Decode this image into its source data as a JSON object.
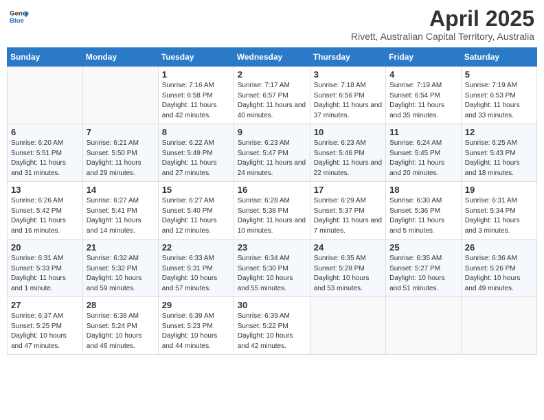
{
  "header": {
    "logo_general": "General",
    "logo_blue": "Blue",
    "month_year": "April 2025",
    "location": "Rivett, Australian Capital Territory, Australia"
  },
  "days_of_week": [
    "Sunday",
    "Monday",
    "Tuesday",
    "Wednesday",
    "Thursday",
    "Friday",
    "Saturday"
  ],
  "weeks": [
    [
      {
        "day": "",
        "sunrise": "",
        "sunset": "",
        "daylight": ""
      },
      {
        "day": "",
        "sunrise": "",
        "sunset": "",
        "daylight": ""
      },
      {
        "day": "1",
        "sunrise": "Sunrise: 7:16 AM",
        "sunset": "Sunset: 6:58 PM",
        "daylight": "Daylight: 11 hours and 42 minutes."
      },
      {
        "day": "2",
        "sunrise": "Sunrise: 7:17 AM",
        "sunset": "Sunset: 6:57 PM",
        "daylight": "Daylight: 11 hours and 40 minutes."
      },
      {
        "day": "3",
        "sunrise": "Sunrise: 7:18 AM",
        "sunset": "Sunset: 6:56 PM",
        "daylight": "Daylight: 11 hours and 37 minutes."
      },
      {
        "day": "4",
        "sunrise": "Sunrise: 7:19 AM",
        "sunset": "Sunset: 6:54 PM",
        "daylight": "Daylight: 11 hours and 35 minutes."
      },
      {
        "day": "5",
        "sunrise": "Sunrise: 7:19 AM",
        "sunset": "Sunset: 6:53 PM",
        "daylight": "Daylight: 11 hours and 33 minutes."
      }
    ],
    [
      {
        "day": "6",
        "sunrise": "Sunrise: 6:20 AM",
        "sunset": "Sunset: 5:51 PM",
        "daylight": "Daylight: 11 hours and 31 minutes."
      },
      {
        "day": "7",
        "sunrise": "Sunrise: 6:21 AM",
        "sunset": "Sunset: 5:50 PM",
        "daylight": "Daylight: 11 hours and 29 minutes."
      },
      {
        "day": "8",
        "sunrise": "Sunrise: 6:22 AM",
        "sunset": "Sunset: 5:49 PM",
        "daylight": "Daylight: 11 hours and 27 minutes."
      },
      {
        "day": "9",
        "sunrise": "Sunrise: 6:23 AM",
        "sunset": "Sunset: 5:47 PM",
        "daylight": "Daylight: 11 hours and 24 minutes."
      },
      {
        "day": "10",
        "sunrise": "Sunrise: 6:23 AM",
        "sunset": "Sunset: 5:46 PM",
        "daylight": "Daylight: 11 hours and 22 minutes."
      },
      {
        "day": "11",
        "sunrise": "Sunrise: 6:24 AM",
        "sunset": "Sunset: 5:45 PM",
        "daylight": "Daylight: 11 hours and 20 minutes."
      },
      {
        "day": "12",
        "sunrise": "Sunrise: 6:25 AM",
        "sunset": "Sunset: 5:43 PM",
        "daylight": "Daylight: 11 hours and 18 minutes."
      }
    ],
    [
      {
        "day": "13",
        "sunrise": "Sunrise: 6:26 AM",
        "sunset": "Sunset: 5:42 PM",
        "daylight": "Daylight: 11 hours and 16 minutes."
      },
      {
        "day": "14",
        "sunrise": "Sunrise: 6:27 AM",
        "sunset": "Sunset: 5:41 PM",
        "daylight": "Daylight: 11 hours and 14 minutes."
      },
      {
        "day": "15",
        "sunrise": "Sunrise: 6:27 AM",
        "sunset": "Sunset: 5:40 PM",
        "daylight": "Daylight: 11 hours and 12 minutes."
      },
      {
        "day": "16",
        "sunrise": "Sunrise: 6:28 AM",
        "sunset": "Sunset: 5:38 PM",
        "daylight": "Daylight: 11 hours and 10 minutes."
      },
      {
        "day": "17",
        "sunrise": "Sunrise: 6:29 AM",
        "sunset": "Sunset: 5:37 PM",
        "daylight": "Daylight: 11 hours and 7 minutes."
      },
      {
        "day": "18",
        "sunrise": "Sunrise: 6:30 AM",
        "sunset": "Sunset: 5:36 PM",
        "daylight": "Daylight: 11 hours and 5 minutes."
      },
      {
        "day": "19",
        "sunrise": "Sunrise: 6:31 AM",
        "sunset": "Sunset: 5:34 PM",
        "daylight": "Daylight: 11 hours and 3 minutes."
      }
    ],
    [
      {
        "day": "20",
        "sunrise": "Sunrise: 6:31 AM",
        "sunset": "Sunset: 5:33 PM",
        "daylight": "Daylight: 11 hours and 1 minute."
      },
      {
        "day": "21",
        "sunrise": "Sunrise: 6:32 AM",
        "sunset": "Sunset: 5:32 PM",
        "daylight": "Daylight: 10 hours and 59 minutes."
      },
      {
        "day": "22",
        "sunrise": "Sunrise: 6:33 AM",
        "sunset": "Sunset: 5:31 PM",
        "daylight": "Daylight: 10 hours and 57 minutes."
      },
      {
        "day": "23",
        "sunrise": "Sunrise: 6:34 AM",
        "sunset": "Sunset: 5:30 PM",
        "daylight": "Daylight: 10 hours and 55 minutes."
      },
      {
        "day": "24",
        "sunrise": "Sunrise: 6:35 AM",
        "sunset": "Sunset: 5:28 PM",
        "daylight": "Daylight: 10 hours and 53 minutes."
      },
      {
        "day": "25",
        "sunrise": "Sunrise: 6:35 AM",
        "sunset": "Sunset: 5:27 PM",
        "daylight": "Daylight: 10 hours and 51 minutes."
      },
      {
        "day": "26",
        "sunrise": "Sunrise: 6:36 AM",
        "sunset": "Sunset: 5:26 PM",
        "daylight": "Daylight: 10 hours and 49 minutes."
      }
    ],
    [
      {
        "day": "27",
        "sunrise": "Sunrise: 6:37 AM",
        "sunset": "Sunset: 5:25 PM",
        "daylight": "Daylight: 10 hours and 47 minutes."
      },
      {
        "day": "28",
        "sunrise": "Sunrise: 6:38 AM",
        "sunset": "Sunset: 5:24 PM",
        "daylight": "Daylight: 10 hours and 46 minutes."
      },
      {
        "day": "29",
        "sunrise": "Sunrise: 6:39 AM",
        "sunset": "Sunset: 5:23 PM",
        "daylight": "Daylight: 10 hours and 44 minutes."
      },
      {
        "day": "30",
        "sunrise": "Sunrise: 6:39 AM",
        "sunset": "Sunset: 5:22 PM",
        "daylight": "Daylight: 10 hours and 42 minutes."
      },
      {
        "day": "",
        "sunrise": "",
        "sunset": "",
        "daylight": ""
      },
      {
        "day": "",
        "sunrise": "",
        "sunset": "",
        "daylight": ""
      },
      {
        "day": "",
        "sunrise": "",
        "sunset": "",
        "daylight": ""
      }
    ]
  ]
}
